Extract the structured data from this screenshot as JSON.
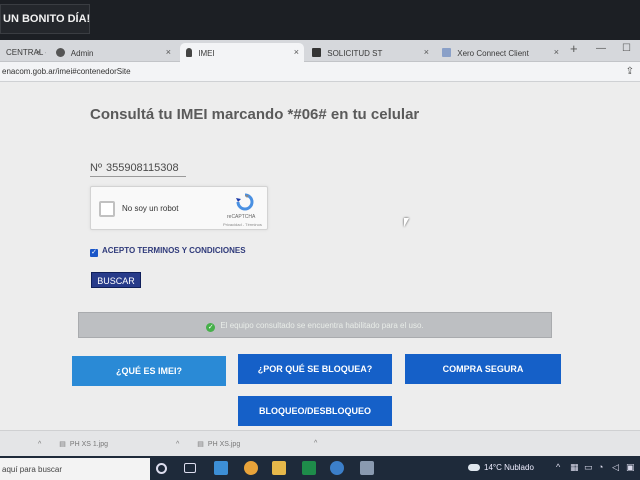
{
  "banner": {
    "text": "UN BONITO DÍA!"
  },
  "tabs": [
    {
      "label": "CENTRAL - ",
      "active": false
    },
    {
      "label": "Admin",
      "active": false
    },
    {
      "label": "IMEI",
      "active": true
    },
    {
      "label": "SOLICITUD ST",
      "active": false
    },
    {
      "label": "Xero Connect Client",
      "active": false
    }
  ],
  "address": {
    "url": "enacom.gob.ar/imei#contenedorSite"
  },
  "page": {
    "title": "Consultá tu IMEI marcando *#06# en tu celular",
    "imei_prefix": "Nº",
    "imei_value": "355908115308",
    "captcha": {
      "label": "No soy un robot",
      "brand": "reCAPTCHA",
      "terms": "Privacidad - Términos"
    },
    "terms_label": "ACEPTO TERMINOS Y CONDICIONES",
    "search_button": "BUSCAR",
    "status_message": "El equipo consultado se encuentra habilitado para el uso.",
    "buttons": {
      "que_es_imei": "¿QUÉ ES IMEI?",
      "por_que": "¿POR QUÉ SE BLOQUEA?",
      "compra_segura": "COMPRA SEGURA",
      "bloqueo": "BLOQUEO/DESBLOQUEO"
    }
  },
  "downloads": [
    {
      "name": "PH XS 1.jpg"
    },
    {
      "name": "PH XS.jpg"
    }
  ],
  "taskbar": {
    "search_placeholder": "aquí para buscar",
    "weather": "14°C  Nublado"
  },
  "colors": {
    "primary_button": "#1560c8",
    "light_button": "#2a8ad6",
    "buscar": "#273b8a",
    "success": "#46b04a"
  }
}
